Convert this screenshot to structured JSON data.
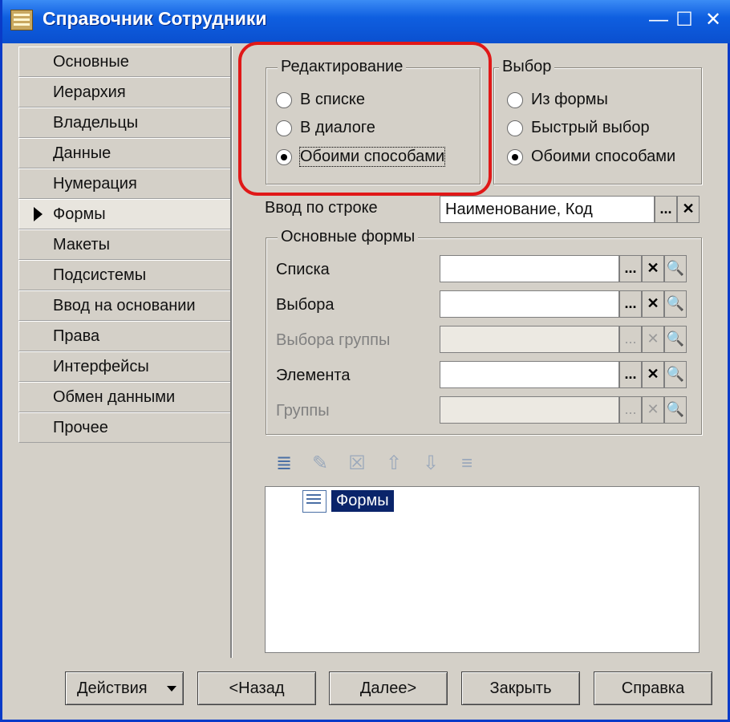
{
  "window": {
    "title": "Справочник Сотрудники",
    "minimize": "—",
    "maximize": "☐",
    "close": "✕"
  },
  "tabs": [
    {
      "label": "Основные"
    },
    {
      "label": "Иерархия"
    },
    {
      "label": "Владельцы"
    },
    {
      "label": "Данные"
    },
    {
      "label": "Нумерация"
    },
    {
      "label": "Формы",
      "active": true
    },
    {
      "label": "Макеты"
    },
    {
      "label": "Подсистемы"
    },
    {
      "label": "Ввод на основании"
    },
    {
      "label": "Права"
    },
    {
      "label": "Интерфейсы"
    },
    {
      "label": "Обмен данными"
    },
    {
      "label": "Прочее"
    }
  ],
  "editing": {
    "title": "Редактирование",
    "options": [
      "В списке",
      "В диалоге",
      "Обоими способами"
    ],
    "selected": "Обоими способами"
  },
  "choice": {
    "title": "Выбор",
    "options": [
      "Из формы",
      "Быстрый выбор",
      "Обоими способами"
    ],
    "selected": "Обоими способами"
  },
  "line_input": {
    "label": "Ввод по строке",
    "value": "Наименование, Код",
    "btn_dots": "...",
    "btn_clear": "✕"
  },
  "main_forms": {
    "title": "Основные формы",
    "rows": [
      {
        "label": "Списка",
        "value": "",
        "disabled": false
      },
      {
        "label": "Выбора",
        "value": "",
        "disabled": false
      },
      {
        "label": "Выбора группы",
        "value": "",
        "disabled": true
      },
      {
        "label": "Элемента",
        "value": "",
        "disabled": false
      },
      {
        "label": "Группы",
        "value": "",
        "disabled": true
      }
    ],
    "btn_dots": "...",
    "btn_clear": "✕",
    "btn_open": "🔍"
  },
  "toolbar_icons": [
    "add-icon",
    "edit-icon",
    "delete-icon",
    "move-up-icon",
    "move-down-icon",
    "sort-icon"
  ],
  "tree": {
    "item_label": "Формы"
  },
  "buttons": {
    "actions": "Действия",
    "back": "<Назад",
    "next": "Далее>",
    "close": "Закрыть",
    "help": "Справка"
  }
}
